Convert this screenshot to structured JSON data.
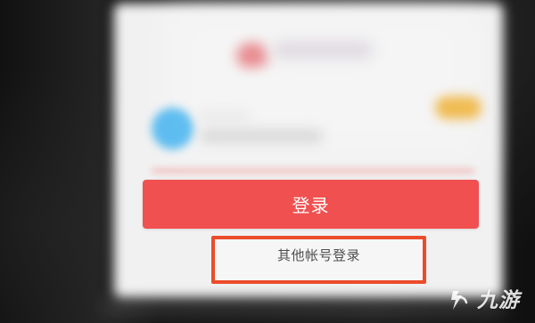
{
  "main": {
    "login_label": "登录",
    "other_account_label": "其他帐号登录"
  },
  "watermark": {
    "text": "九游"
  },
  "colors": {
    "login_button": "#f15050",
    "highlight_border": "#eb4c2b",
    "avatar_blue": "#3fb1f0",
    "badge_yellow": "#f0bb52"
  }
}
